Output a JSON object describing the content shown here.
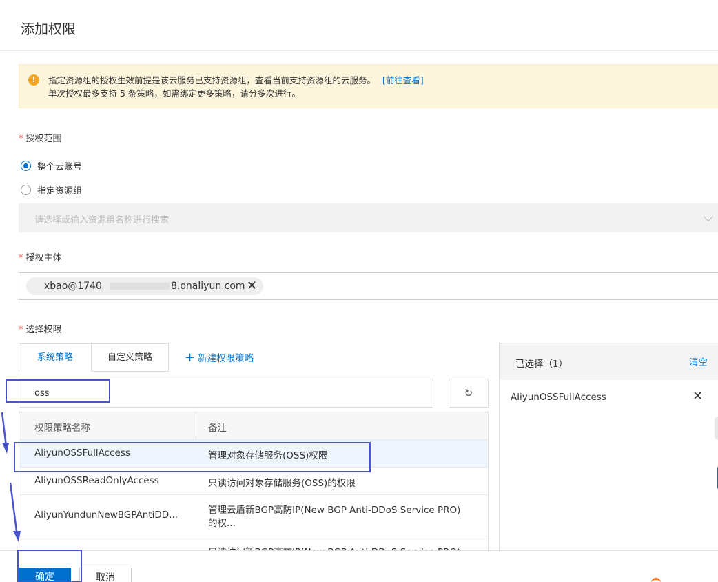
{
  "header": {
    "title": "添加权限"
  },
  "alert": {
    "line1": "指定资源组的授权生效前提是该云服务已支持资源组，查看当前支持资源组的云服务。",
    "link": "[前往查看]",
    "line2": "单次授权最多支持 5 条策略，如需绑定更多策略，请分多次进行。"
  },
  "scope": {
    "label": "授权范围",
    "options": [
      {
        "label": "整个云账号",
        "selected": true
      },
      {
        "label": "指定资源组",
        "selected": false
      }
    ],
    "select_placeholder": "请选择或输入资源组名称进行搜索"
  },
  "principal": {
    "label": "授权主体",
    "tag_prefix": "xbao@1740",
    "tag_suffix": "8.onaliyun.com"
  },
  "permissions": {
    "label": "选择权限",
    "tabs": [
      {
        "label": "系统策略",
        "active": true
      },
      {
        "label": "自定义策略",
        "active": false
      }
    ],
    "new_policy": "新建权限策略",
    "search_value": "oss",
    "table": {
      "columns": [
        "权限策略名称",
        "备注"
      ],
      "rows": [
        {
          "name": "AliyunOSSFullAccess",
          "note": "管理对象存储服务(OSS)权限",
          "selected": true
        },
        {
          "name": "AliyunOSSReadOnlyAccess",
          "note": "只读访问对象存储服务(OSS)的权限",
          "selected": false
        },
        {
          "name": "AliyunYundunNewBGPAntiDD...",
          "note": "管理云盾新BGP高防IP(New BGP Anti-DDoS Service PRO)",
          "note2": "的权...",
          "selected": false
        },
        {
          "name": "",
          "note": "只读访问新BGP高防IP(New BGP Anti-DDoS Service PRO)",
          "selected": false
        }
      ]
    }
  },
  "selected_panel": {
    "title": "已选择（1）",
    "clear": "清空",
    "items": [
      "AliyunOSSFullAccess"
    ]
  },
  "footer": {
    "ok": "确定",
    "cancel": "取消"
  },
  "colors": {
    "accent": "#0070cc",
    "annotation": "#4a54cc",
    "alert_bg": "#fdf5dc"
  }
}
